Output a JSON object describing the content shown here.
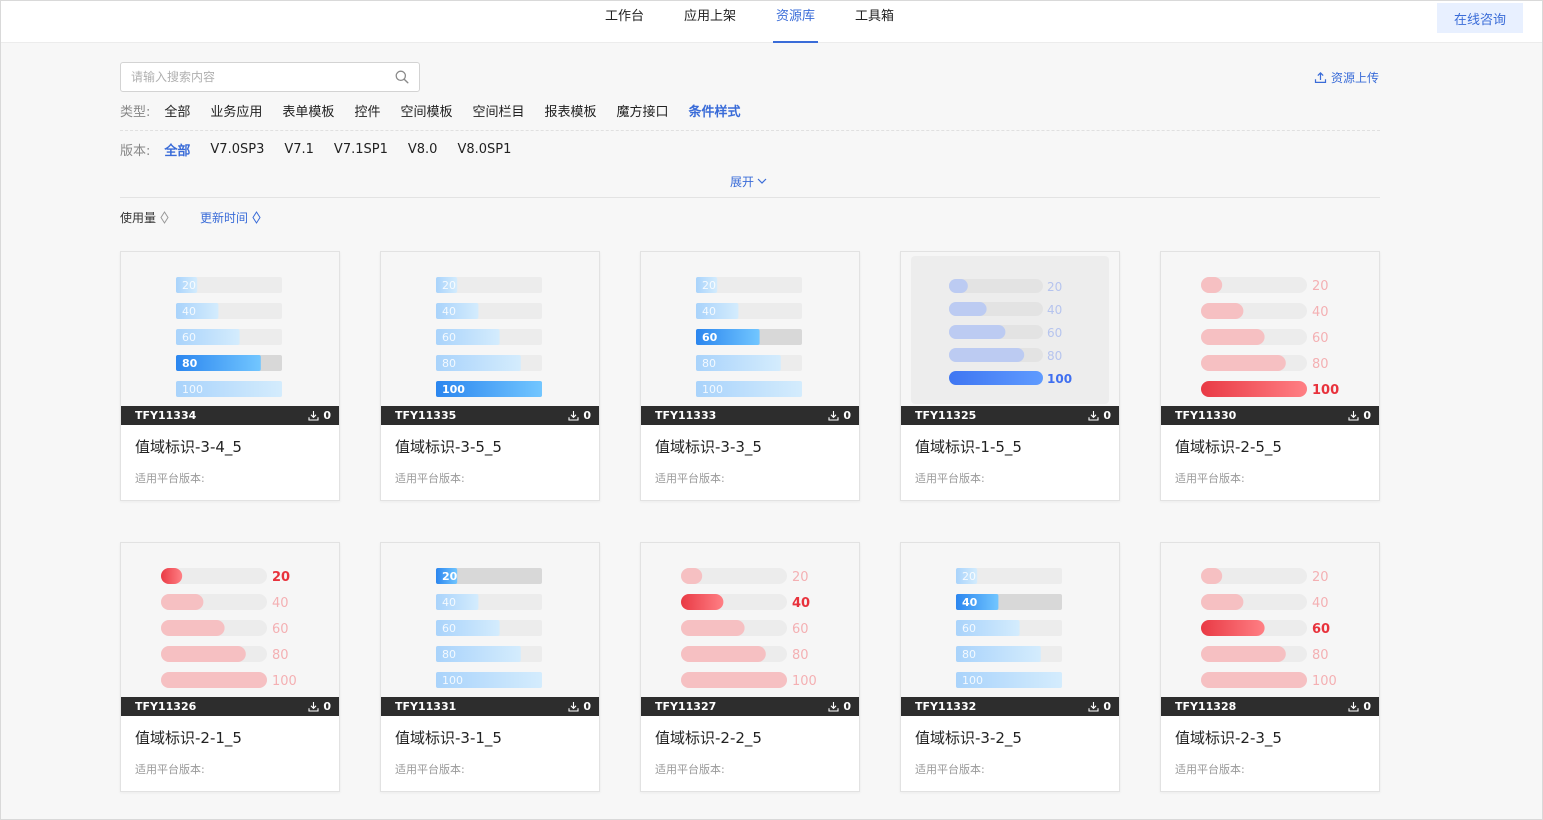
{
  "nav": {
    "tabs": [
      {
        "label": "工作台",
        "active": false
      },
      {
        "label": "应用上架",
        "active": false
      },
      {
        "label": "资源库",
        "active": true
      },
      {
        "label": "工具箱",
        "active": false
      }
    ],
    "consult_label": "在线咨询"
  },
  "search": {
    "placeholder": "请输入搜索内容",
    "value": ""
  },
  "upload_label": "资源上传",
  "filters": {
    "type": {
      "label": "类型:",
      "options": [
        "全部",
        "业务应用",
        "表单模板",
        "控件",
        "空间模板",
        "空间栏目",
        "报表模板",
        "魔方接口",
        "条件样式"
      ],
      "selected": "条件样式"
    },
    "version": {
      "label": "版本:",
      "options": [
        "全部",
        "V7.0SP3",
        "V7.1",
        "V7.1SP1",
        "V8.0",
        "V8.0SP1"
      ],
      "selected": "全部"
    },
    "expand_label": "展开"
  },
  "sort": {
    "usage_label": "使用量",
    "time_label": "更新时间",
    "active": "time"
  },
  "colors": {
    "accent": "#3a6cd8",
    "blue_bar": "#2f8ef0",
    "red_bar": "#f05a5a",
    "track": "#e6e6e6"
  },
  "cards": [
    {
      "code": "TFY11334",
      "downloads": "0",
      "title": "值域标识-3-4_5",
      "platform": "适用平台版本:",
      "preview": {
        "style": "blue-square",
        "highlight": 4,
        "labels": [
          "20",
          "40",
          "60",
          "80",
          "100"
        ],
        "values": [
          20,
          40,
          60,
          80,
          100
        ]
      }
    },
    {
      "code": "TFY11335",
      "downloads": "0",
      "title": "值域标识-3-5_5",
      "platform": "适用平台版本:",
      "preview": {
        "style": "blue-square",
        "highlight": 5,
        "labels": [
          "20",
          "40",
          "60",
          "80",
          "100"
        ],
        "values": [
          20,
          40,
          60,
          80,
          100
        ]
      }
    },
    {
      "code": "TFY11333",
      "downloads": "0",
      "title": "值域标识-3-3_5",
      "platform": "适用平台版本:",
      "preview": {
        "style": "blue-square",
        "highlight": 3,
        "labels": [
          "20",
          "40",
          "60",
          "80",
          "100"
        ],
        "values": [
          20,
          40,
          60,
          80,
          100
        ]
      }
    },
    {
      "code": "TFY11325",
      "downloads": "0",
      "title": "值域标识-1-5_5",
      "platform": "适用平台版本:",
      "preview": {
        "style": "blue-pill",
        "highlight": 5,
        "labels": [
          "20",
          "40",
          "60",
          "80",
          "100"
        ],
        "values": [
          20,
          40,
          60,
          80,
          100
        ]
      }
    },
    {
      "code": "TFY11330",
      "downloads": "0",
      "title": "值域标识-2-5_5",
      "platform": "适用平台版本:",
      "preview": {
        "style": "red-pill",
        "highlight": 5,
        "labels": [
          "20",
          "40",
          "60",
          "80",
          "100"
        ],
        "values": [
          20,
          40,
          60,
          80,
          100
        ]
      }
    },
    {
      "code": "TFY11326",
      "downloads": "0",
      "title": "值域标识-2-1_5",
      "platform": "适用平台版本:",
      "preview": {
        "style": "red-pill",
        "highlight": 1,
        "labels": [
          "20",
          "40",
          "60",
          "80",
          "100"
        ],
        "values": [
          20,
          40,
          60,
          80,
          100
        ]
      }
    },
    {
      "code": "TFY11331",
      "downloads": "0",
      "title": "值域标识-3-1_5",
      "platform": "适用平台版本:",
      "preview": {
        "style": "blue-square",
        "highlight": 1,
        "labels": [
          "20",
          "40",
          "60",
          "80",
          "100"
        ],
        "values": [
          20,
          40,
          60,
          80,
          100
        ]
      }
    },
    {
      "code": "TFY11327",
      "downloads": "0",
      "title": "值域标识-2-2_5",
      "platform": "适用平台版本:",
      "preview": {
        "style": "red-pill",
        "highlight": 2,
        "labels": [
          "20",
          "40",
          "60",
          "80",
          "100"
        ],
        "values": [
          20,
          40,
          60,
          80,
          100
        ]
      }
    },
    {
      "code": "TFY11332",
      "downloads": "0",
      "title": "值域标识-3-2_5",
      "platform": "适用平台版本:",
      "preview": {
        "style": "blue-square",
        "highlight": 2,
        "labels": [
          "20",
          "40",
          "60",
          "80",
          "100"
        ],
        "values": [
          20,
          40,
          60,
          80,
          100
        ]
      }
    },
    {
      "code": "TFY11328",
      "downloads": "0",
      "title": "值域标识-2-3_5",
      "platform": "适用平台版本:",
      "preview": {
        "style": "red-pill",
        "highlight": 3,
        "labels": [
          "20",
          "40",
          "60",
          "80",
          "100"
        ],
        "values": [
          20,
          40,
          60,
          80,
          100
        ]
      }
    }
  ]
}
